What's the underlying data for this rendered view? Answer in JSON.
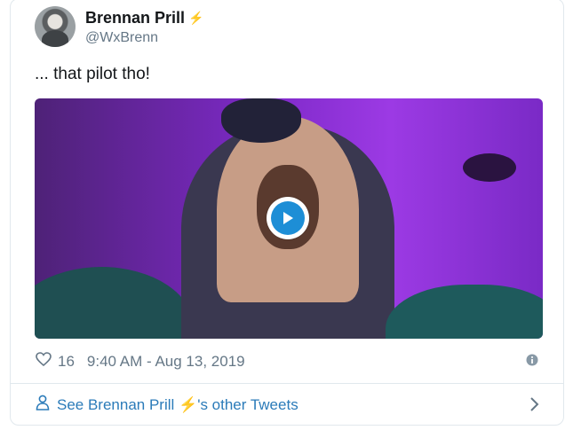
{
  "tweet": {
    "author_name": "Brennan Prill",
    "author_badge": "⚡",
    "handle": "@WxBrenn",
    "text": "... that pilot tho!",
    "likes": "16",
    "timestamp": "9:40 AM - Aug 13, 2019"
  },
  "footer": {
    "link_prefix": "See Brennan Prill ",
    "link_badge": "⚡",
    "link_suffix": "'s other Tweets"
  },
  "icons": {
    "avatar": "avatar",
    "verified": "lightning-icon",
    "play": "play-icon",
    "like": "heart-icon",
    "info": "info-icon",
    "user": "user-icon",
    "chevron": "chevron-right-icon"
  },
  "colors": {
    "link": "#2b7bb9",
    "muted": "#657786",
    "play_accent": "#1d8ed6"
  }
}
